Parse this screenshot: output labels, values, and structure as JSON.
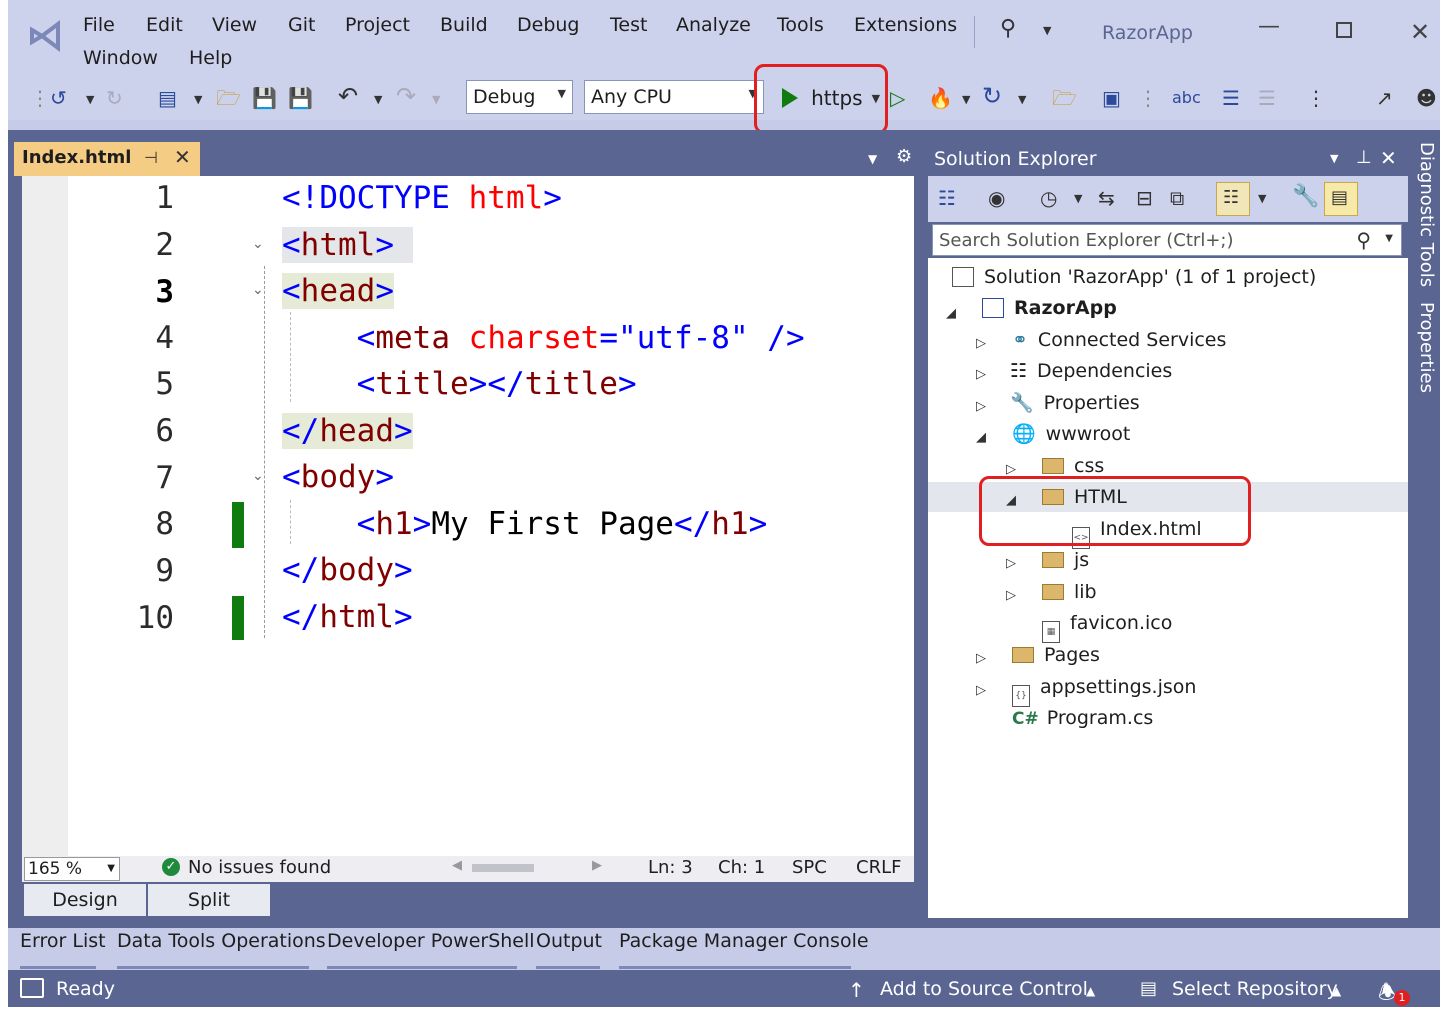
{
  "menu": {
    "items": [
      "File",
      "Edit",
      "View",
      "Git",
      "Project",
      "Build",
      "Debug",
      "Test",
      "Analyze",
      "Tools",
      "Extensions",
      "Window",
      "Help"
    ],
    "app_title": "RazorApp"
  },
  "toolbar": {
    "config": "Debug",
    "platform": "Any CPU",
    "run_target": "https"
  },
  "editor": {
    "tab_label": "Index.html",
    "line_numbers": [
      "1",
      "2",
      "3",
      "4",
      "5",
      "6",
      "7",
      "8",
      "9",
      "10"
    ],
    "zoom": "165 %",
    "issues": "No issues found",
    "ln": "Ln: 3",
    "ch": "Ch: 1",
    "spc": "SPC",
    "crlf": "CRLF",
    "design_tab": "Design",
    "split_tab": "Split"
  },
  "solution_explorer": {
    "title": "Solution Explorer",
    "search_placeholder": "Search Solution Explorer (Ctrl+;)",
    "items": [
      "Solution 'RazorApp' (1 of 1 project)",
      "RazorApp",
      "Connected Services",
      "Dependencies",
      "Properties",
      "wwwroot",
      "css",
      "HTML",
      "Index.html",
      "js",
      "lib",
      "favicon.ico",
      "Pages",
      "appsettings.json",
      "Program.cs"
    ]
  },
  "side_tabs": [
    "Diagnostic Tools",
    "Properties"
  ],
  "bottom_tabs": [
    "Error List",
    "Data Tools Operations",
    "Developer PowerShell",
    "Output",
    "Package Manager Console"
  ],
  "status": {
    "ready": "Ready",
    "source_control": "Add to Source Control",
    "repository": "Select Repository",
    "notification_count": "1"
  },
  "colors": {
    "accent": "#5a6592",
    "highlight_box": "#e02020",
    "tab_active": "#f5cc84",
    "change_bar": "#107c10"
  }
}
